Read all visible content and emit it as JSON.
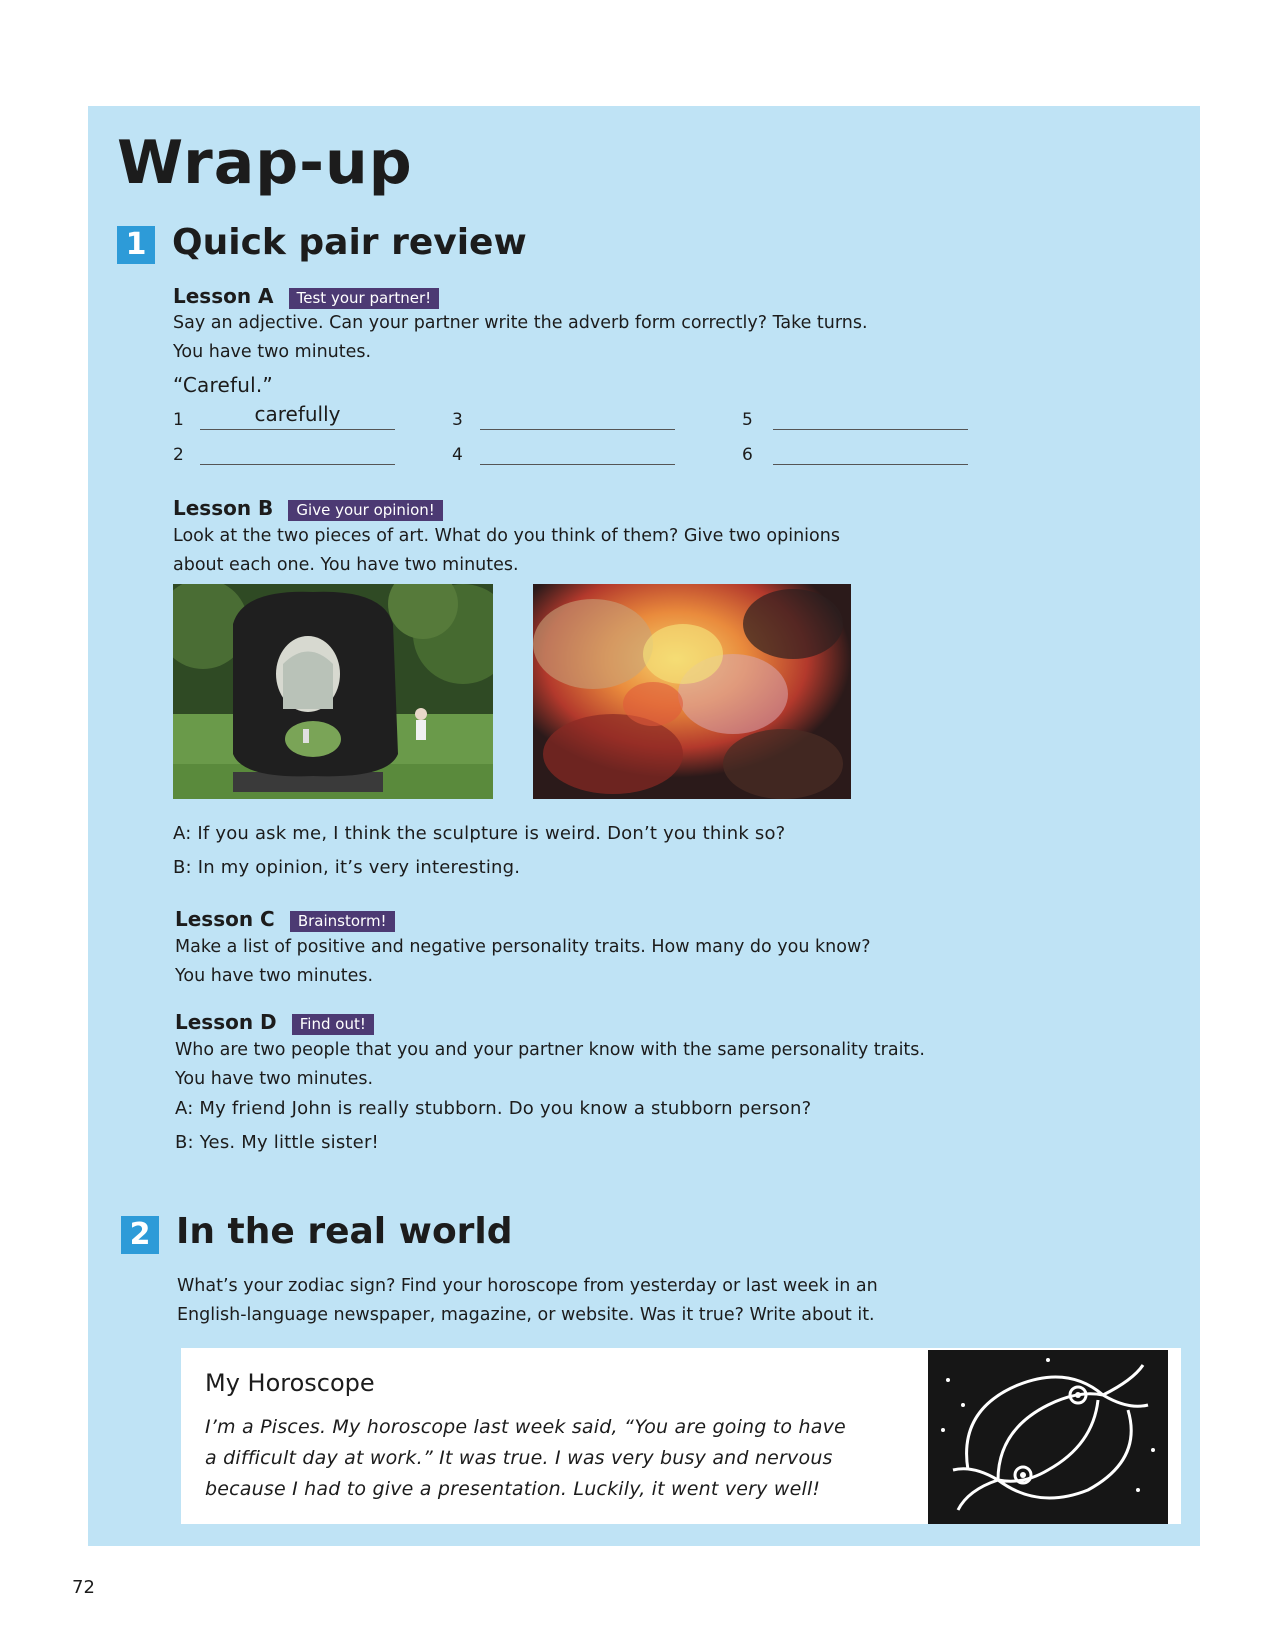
{
  "page": {
    "title": "Wrap-up",
    "page_number": "72"
  },
  "section1": {
    "number": "1",
    "title": "Quick pair review",
    "lesson_a": {
      "label": "Lesson A",
      "tag": "Test your partner!",
      "instructions_1": "Say an adjective. Can your partner write the adverb form correctly? Take turns.",
      "instructions_2": "You have two minutes.",
      "example": "“Careful.”",
      "blanks": [
        {
          "n": "1",
          "answer": "carefully"
        },
        {
          "n": "2",
          "answer": ""
        },
        {
          "n": "3",
          "answer": ""
        },
        {
          "n": "4",
          "answer": ""
        },
        {
          "n": "5",
          "answer": ""
        },
        {
          "n": "6",
          "answer": ""
        }
      ]
    },
    "lesson_b": {
      "label": "Lesson B",
      "tag": "Give your opinion!",
      "instructions_1": "Look at the two pieces of art. What do you think of them? Give two opinions",
      "instructions_2": "about each one. You have two minutes.",
      "dialog": [
        {
          "speaker": "A:",
          "text": "If you ask me, I think the sculpture is weird. Don’t you think so?"
        },
        {
          "speaker": "B:",
          "text": "In my opinion, it’s very interesting."
        }
      ]
    },
    "lesson_c": {
      "label": "Lesson C",
      "tag": "Brainstorm!",
      "instructions_1": "Make a list of positive and negative personality traits. How many do you know?",
      "instructions_2": "You have two minutes."
    },
    "lesson_d": {
      "label": "Lesson D",
      "tag": "Find out!",
      "instructions_1": "Who are two people that you and your partner know with the same personality traits.",
      "instructions_2": "You have two minutes.",
      "dialog": [
        {
          "speaker": "A:",
          "text": "My friend John is really stubborn. Do you know a stubborn person?"
        },
        {
          "speaker": "B:",
          "text": "Yes. My little sister!"
        }
      ]
    }
  },
  "section2": {
    "number": "2",
    "title": "In the real world",
    "instructions_1": "What’s your zodiac sign? Find your horoscope from yesterday or last week in an",
    "instructions_2": "English-language newspaper, magazine, or website. Was it true? Write about it.",
    "horoscope": {
      "title": "My Horoscope",
      "line_1": "I’m a Pisces. My horoscope last week said, “You are going to have",
      "line_2": "a difficult day at work.” It was true. I was very busy and nervous",
      "line_3": "because I had to give a presentation. Luckily, it went very well!"
    }
  },
  "colors": {
    "panel": "#bfe3f5",
    "section_number": "#2d9bd8",
    "tag": "#4c3a73"
  }
}
